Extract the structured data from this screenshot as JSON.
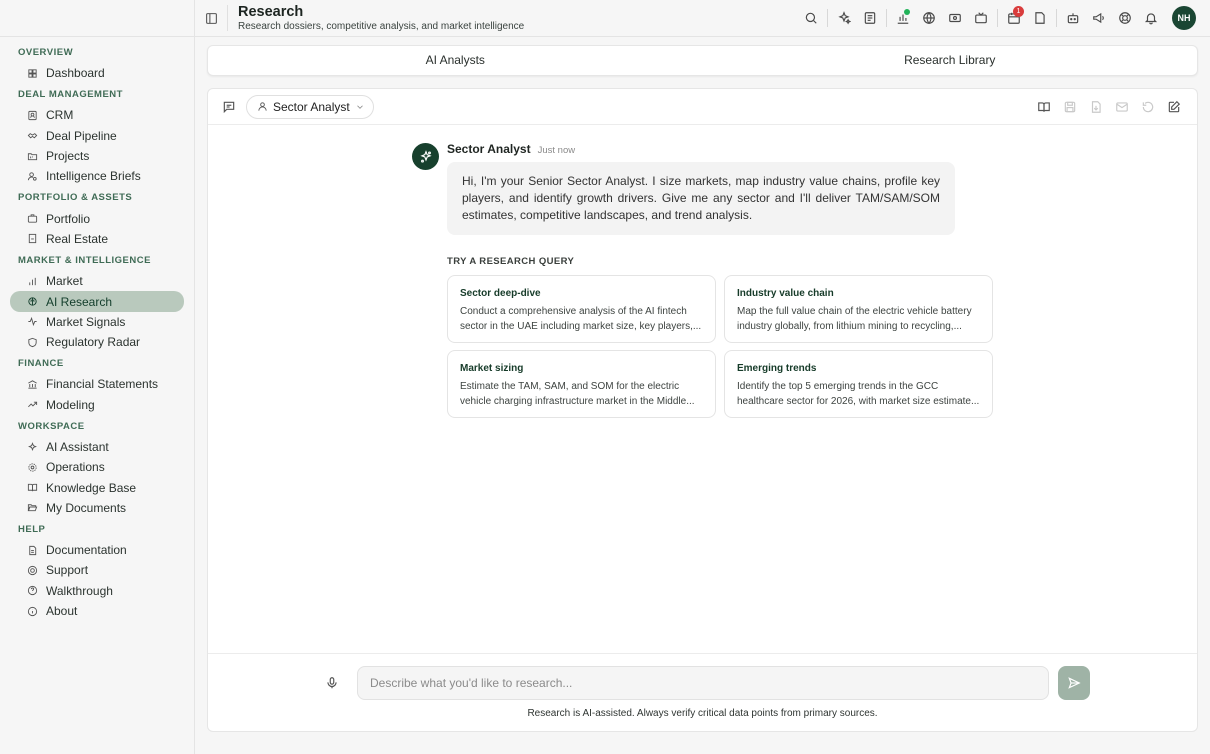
{
  "sidebar": {
    "sections": [
      {
        "title": "OVERVIEW",
        "items": [
          {
            "label": "Dashboard",
            "icon": "grid-icon"
          }
        ]
      },
      {
        "title": "DEAL MANAGEMENT",
        "items": [
          {
            "label": "CRM",
            "icon": "contact-icon"
          },
          {
            "label": "Deal Pipeline",
            "icon": "handshake-icon"
          },
          {
            "label": "Projects",
            "icon": "folder-kanban-icon"
          },
          {
            "label": "Intelligence Briefs",
            "icon": "user-search-icon"
          }
        ]
      },
      {
        "title": "PORTFOLIO & ASSETS",
        "items": [
          {
            "label": "Portfolio",
            "icon": "briefcase-icon"
          },
          {
            "label": "Real Estate",
            "icon": "building-icon"
          }
        ]
      },
      {
        "title": "MARKET & INTELLIGENCE",
        "items": [
          {
            "label": "Market",
            "icon": "bar-chart-icon"
          },
          {
            "label": "AI Research",
            "icon": "brain-icon",
            "active": true
          },
          {
            "label": "Market Signals",
            "icon": "activity-icon"
          },
          {
            "label": "Regulatory Radar",
            "icon": "shield-icon"
          }
        ]
      },
      {
        "title": "FINANCE",
        "items": [
          {
            "label": "Financial Statements",
            "icon": "bank-icon"
          },
          {
            "label": "Modeling",
            "icon": "trending-up-icon"
          }
        ]
      },
      {
        "title": "WORKSPACE",
        "items": [
          {
            "label": "AI Assistant",
            "icon": "sparkles-icon"
          },
          {
            "label": "Operations",
            "icon": "cog-icon"
          },
          {
            "label": "Knowledge Base",
            "icon": "book-open-icon"
          },
          {
            "label": "My Documents",
            "icon": "folder-open-icon"
          }
        ]
      },
      {
        "title": "HELP",
        "items": [
          {
            "label": "Documentation",
            "icon": "file-text-icon"
          },
          {
            "label": "Support",
            "icon": "lifebuoy-icon"
          },
          {
            "label": "Walkthrough",
            "icon": "help-circle-icon"
          },
          {
            "label": "About",
            "icon": "info-icon"
          }
        ]
      }
    ]
  },
  "header": {
    "title": "Research",
    "subtitle": "Research dossiers, competitive analysis, and market intelligence",
    "notification_count": "1",
    "avatar_initials": "NH"
  },
  "tabs": [
    {
      "label": "AI Analysts"
    },
    {
      "label": "Research Library"
    }
  ],
  "agent": {
    "selected": "Sector Analyst"
  },
  "message": {
    "sender": "Sector Analyst",
    "time": "Just now",
    "text": "Hi, I'm your Senior Sector Analyst. I size markets, map industry value chains, profile key players, and identify growth drivers. Give me any sector and I'll deliver TAM/SAM/SOM estimates, competitive landscapes, and trend analysis."
  },
  "suggestions": {
    "label": "TRY A RESEARCH QUERY",
    "cards": [
      {
        "title": "Sector deep-dive",
        "text": "Conduct a comprehensive analysis of the AI fintech sector in the UAE including market size, key players,..."
      },
      {
        "title": "Industry value chain",
        "text": "Map the full value chain of the electric vehicle battery industry globally, from lithium mining to recycling,..."
      },
      {
        "title": "Market sizing",
        "text": "Estimate the TAM, SAM, and SOM for the electric vehicle charging infrastructure market in the Middle..."
      },
      {
        "title": "Emerging trends",
        "text": "Identify the top 5 emerging trends in the GCC healthcare sector for 2026, with market size estimate..."
      }
    ]
  },
  "composer": {
    "placeholder": "Describe what you'd like to research...",
    "disclaimer": "Research is AI-assisted. Always verify critical data points from primary sources."
  },
  "colors": {
    "brand": "#17402d",
    "active_nav": "#b9c9bd",
    "accent_text": "#3f6b55",
    "badge": "#d93c3c",
    "online": "#22b35a"
  }
}
